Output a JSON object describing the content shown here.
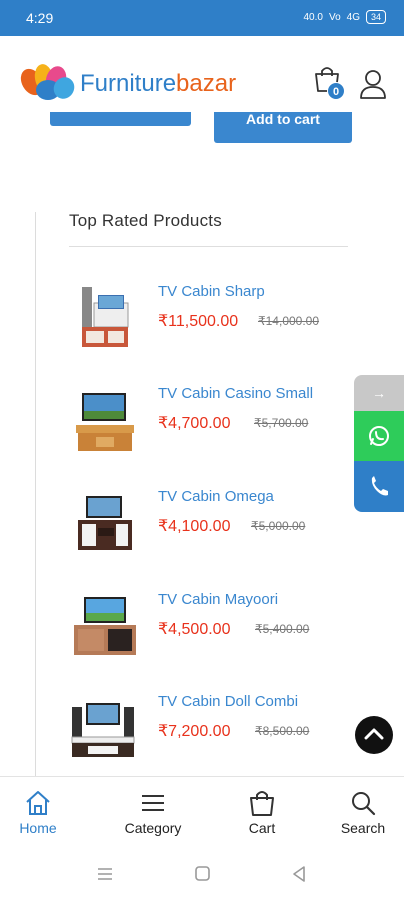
{
  "status": {
    "time": "4:29",
    "net1": "40.0",
    "net2": "Vo",
    "net3": "4G",
    "battery": "34"
  },
  "header": {
    "logo_part1": "Furniture",
    "logo_part2": "bazar",
    "cart_count": "0"
  },
  "cta": {
    "add_to_cart": "Add to cart"
  },
  "section": {
    "title": "Top Rated Products"
  },
  "products": [
    {
      "name": "TV Cabin Sharp",
      "price": "₹11,500.00",
      "old_price": "₹14,000.00"
    },
    {
      "name": "TV Cabin Casino Small",
      "price": "₹4,700.00",
      "old_price": "₹5,700.00"
    },
    {
      "name": "TV Cabin Omega",
      "price": "₹4,100.00",
      "old_price": "₹5,000.00"
    },
    {
      "name": "TV Cabin Mayoori",
      "price": "₹4,500.00",
      "old_price": "₹5,400.00"
    },
    {
      "name": "TV Cabin Doll Combi",
      "price": "₹7,200.00",
      "old_price": "₹8,500.00"
    }
  ],
  "side": {
    "arrow": "→"
  },
  "bottom_nav": {
    "home": "Home",
    "category": "Category",
    "cart": "Cart",
    "search": "Search"
  },
  "colors": {
    "primary": "#2f7fc8",
    "accent": "#e8631c",
    "price": "#e8321c",
    "whatsapp": "#2ecc5a"
  }
}
